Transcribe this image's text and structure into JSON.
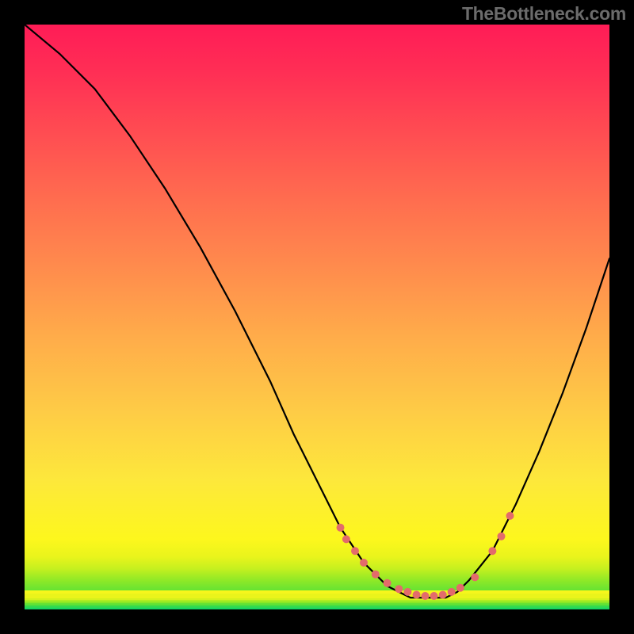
{
  "watermark": "TheBottleneck.com",
  "chart_data": {
    "type": "line",
    "title": "",
    "xlabel": "",
    "ylabel": "",
    "xlim": [
      0,
      100
    ],
    "ylim": [
      0,
      100
    ],
    "grid": false,
    "series": [
      {
        "name": "bottleneck-curve",
        "color": "#000000",
        "x": [
          0,
          6,
          12,
          18,
          24,
          30,
          36,
          42,
          46,
          50,
          54,
          58,
          60,
          62,
          64,
          66,
          68,
          70,
          72,
          74,
          76,
          80,
          84,
          88,
          92,
          96,
          100
        ],
        "y": [
          100,
          95,
          89,
          81,
          72,
          62,
          51,
          39,
          30,
          22,
          14,
          8,
          6,
          4,
          3,
          2,
          2,
          2,
          2,
          3,
          5,
          10,
          18,
          27,
          37,
          48,
          60
        ]
      }
    ],
    "markers": {
      "name": "highlight-dots",
      "color": "#e36b6b",
      "radius_px": 5,
      "points_xy": [
        [
          54,
          14
        ],
        [
          55,
          12
        ],
        [
          56.5,
          10
        ],
        [
          58,
          8
        ],
        [
          60,
          6
        ],
        [
          62,
          4.5
        ],
        [
          64,
          3.5
        ],
        [
          65.5,
          3
        ],
        [
          67,
          2.5
        ],
        [
          68.5,
          2.3
        ],
        [
          70,
          2.3
        ],
        [
          71.5,
          2.5
        ],
        [
          73,
          3
        ],
        [
          74.5,
          3.7
        ],
        [
          77,
          5.5
        ],
        [
          80,
          10
        ],
        [
          81.5,
          12.5
        ],
        [
          83,
          16
        ]
      ]
    },
    "background_gradient": {
      "top": "#ff1c56",
      "mid": "#ffd73f",
      "bottom": "#18d462"
    }
  }
}
